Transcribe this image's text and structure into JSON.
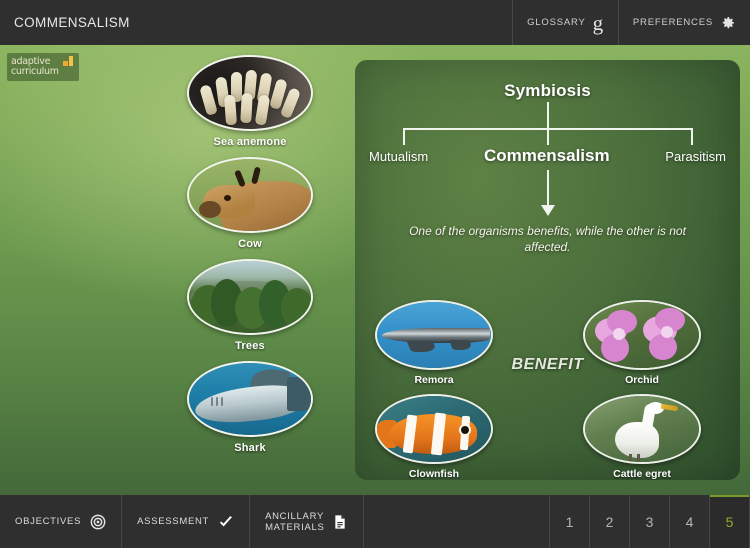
{
  "header": {
    "title": "COMMENSALISM",
    "glossary_label": "GLOSSARY",
    "glossary_icon": "glossary-g-icon",
    "preferences_label": "PREFERENCES",
    "preferences_icon": "gear-icon"
  },
  "logo": {
    "line1": "adaptive",
    "line2": "curriculum",
    "icon": "blocks-icon",
    "accent": "#f0a830"
  },
  "left_examples": [
    {
      "label": "Sea anemone",
      "art": "sea-anemone"
    },
    {
      "label": "Cow",
      "art": "cow"
    },
    {
      "label": "Trees",
      "art": "trees"
    },
    {
      "label": "Shark",
      "art": "shark"
    }
  ],
  "diagram": {
    "root": "Symbiosis",
    "branch_left": "Mutualism",
    "branch_middle": "Commensalism",
    "branch_right": "Parasitism",
    "definition": "One of the organisms benefits, while the other is not affected.",
    "benefit_label": "BENEFIT",
    "organisms": [
      {
        "label": "Remora",
        "art": "remora",
        "position": "top-left"
      },
      {
        "label": "Orchid",
        "art": "orchid",
        "position": "top-right"
      },
      {
        "label": "Clownfish",
        "art": "clownfish",
        "position": "bottom-left"
      },
      {
        "label": "Cattle egret",
        "art": "cattle-egret",
        "position": "bottom-right"
      }
    ]
  },
  "toolbar": {
    "objectives_label": "OBJECTIVES",
    "objectives_icon": "target-icon",
    "assessment_label": "ASSESSMENT",
    "assessment_icon": "check-icon",
    "ancillary_line1": "ANCILLARY",
    "ancillary_line2": "MATERIALS",
    "ancillary_icon": "document-icon"
  },
  "pagination": {
    "pages": [
      "1",
      "2",
      "3",
      "4",
      "5"
    ],
    "active": "5",
    "active_color": "#8fae2b"
  },
  "colors": {
    "chrome": "#2f2f2f",
    "stage_top": "#8ab45f",
    "stage_bottom": "#44683a",
    "panel": "#4c6f3c",
    "accent": "#7a9a2e"
  }
}
